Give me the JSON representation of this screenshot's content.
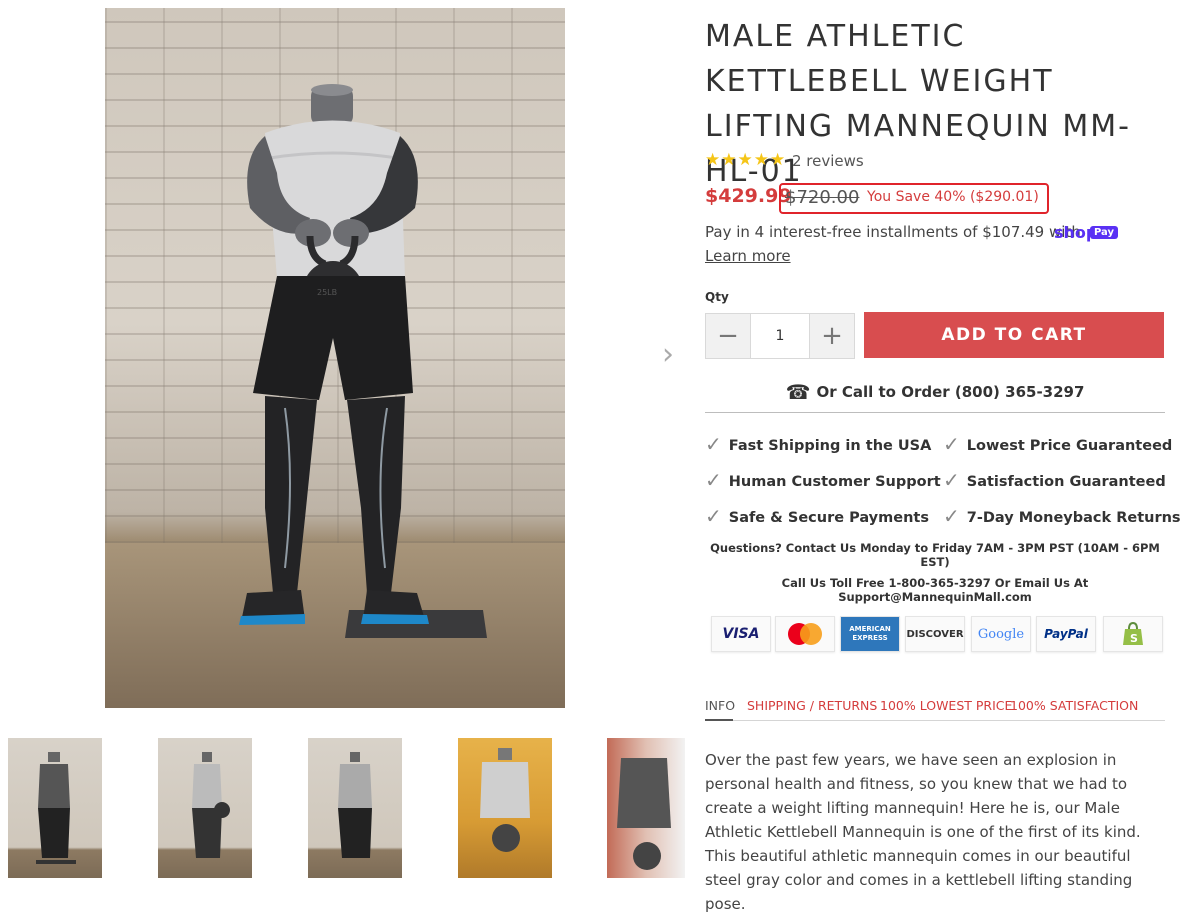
{
  "product": {
    "title": "MALE ATHLETIC KETTLEBELL WEIGHT LIFTING MANNEQUIN MM-HL-01",
    "rating": 5,
    "stars": "★★★★★",
    "reviews": "2 reviews",
    "price": "$429.99",
    "compare_price": "$720.00",
    "savings": "You Save 40% ($290.01)",
    "installments": "Pay in 4 interest-free installments of $107.49 with",
    "shop_pay": "shop",
    "shop_pay_badge": "Pay",
    "learn_more": "Learn more"
  },
  "purchase": {
    "qty_label": "Qty",
    "qty_value": "1",
    "minus": "−",
    "plus": "+",
    "add_to_cart": "ADD TO CART",
    "call_to_order": "Or Call to Order (800) 365-3297"
  },
  "features": [
    "Fast Shipping in the USA",
    "Lowest Price Guaranteed",
    "Human Customer Support",
    "Satisfaction Guaranteed",
    "Safe & Secure Payments",
    "7-Day Moneyback Returns"
  ],
  "contact": {
    "hours": "Questions? Contact Us Monday to Friday 7AM - 3PM PST (10AM - 6PM EST)",
    "phone_email": "Call Us Toll Free 1-800-365-3297 Or Email Us At Support@MannequinMall.com"
  },
  "payment_cards": [
    {
      "label": "VISA",
      "color": "#1a1f71"
    },
    {
      "label": "MasterCard",
      "color": "#eb001b"
    },
    {
      "label": "AMERICAN EXPRESS",
      "color": "#ffffff"
    },
    {
      "label": "DISCOVER",
      "color": "#333333"
    },
    {
      "label": "Google",
      "color": "#4285f4"
    },
    {
      "label": "PayPal",
      "color": "#003087"
    },
    {
      "label": "shopify-bag-icon",
      "color": "#95bf47"
    }
  ],
  "tabs": [
    "INFO",
    "SHIPPING / RETURNS",
    "100% LOWEST PRICE",
    "100% SATISFACTION"
  ],
  "description": "Over the past few years, we have seen an explosion in personal health and fitness, so you knew that we had to create a weight lifting mannequin! Here he is, our Male Athletic Kettlebell Mannequin is one of the first of its kind. This beautiful athletic mannequin comes in our beautiful steel gray color and comes in a kettlebell lifting standing pose.",
  "gallery": {
    "prev_arrow": "‹",
    "next_arrow": "›",
    "kettlebell_label": "25LB"
  },
  "colors": {
    "accent_red": "#d84d4f",
    "price_red": "#d43c3c",
    "shop_pay_purple": "#5a31f4",
    "highlight_box": "#e0242b"
  }
}
